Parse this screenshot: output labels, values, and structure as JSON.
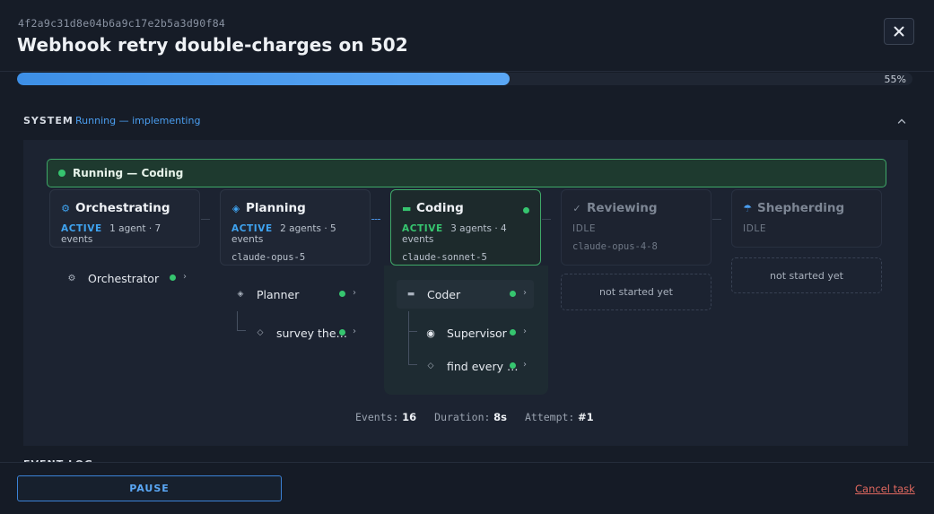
{
  "header": {
    "task_id": "4f2a9c31d8e04b6a9c17e2b5a3d90f84",
    "title": "Webhook retry double-charges on 502"
  },
  "progress": {
    "value": 0.55,
    "label": "55%"
  },
  "system": {
    "label": "SYSTEM",
    "status": "Running — implementing",
    "banner": "Running — Coding"
  },
  "stages": [
    {
      "name": "Orchestrating",
      "icon": "gear-icon",
      "status": "ACTIVE",
      "meta": "1 agent · 7 events",
      "model": ""
    },
    {
      "name": "Planning",
      "icon": "diamond-icon",
      "status": "ACTIVE",
      "meta": "2 agents · 5 events",
      "model": "claude-opus-5"
    },
    {
      "name": "Coding",
      "icon": "terminal-icon",
      "status": "ACTIVE",
      "meta": "3 agents · 4 events",
      "model": "claude-sonnet-5"
    },
    {
      "name": "Reviewing",
      "icon": "check-icon",
      "status": "IDLE",
      "meta": "",
      "model": "claude-opus-4-8"
    },
    {
      "name": "Shepherding",
      "icon": "umbrella-icon",
      "status": "IDLE",
      "meta": "",
      "model": ""
    }
  ],
  "agents": {
    "orchestrator": "Orchestrator",
    "planner": "Planner",
    "planner_child": "survey the…",
    "coder": "Coder",
    "supervisor": "Supervisor",
    "coder_child": "find every …"
  },
  "placeholders": {
    "reviewing": "not started yet",
    "shepherding": "not started yet"
  },
  "stats": {
    "events_label": "Events:",
    "events": "16",
    "duration_label": "Duration:",
    "duration": "8s",
    "attempt_label": "Attempt:",
    "attempt": "#1"
  },
  "event_log": {
    "label": "EVENT LOG"
  },
  "footer": {
    "pause_label": "PAUSE",
    "cancel_label": "Cancel task"
  },
  "colors": {
    "accent": "#4a9ef0",
    "success": "#36c56f",
    "danger": "#e0685f"
  }
}
